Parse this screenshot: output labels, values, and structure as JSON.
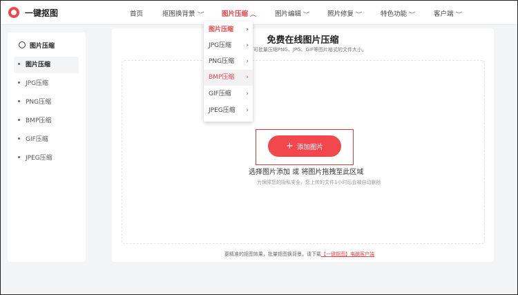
{
  "brand": {
    "name": "一键抠图"
  },
  "nav": {
    "home": "首页",
    "bg_change": "抠图换背景",
    "compress": "图片压缩",
    "edit": "图片编辑",
    "repair": "照片修复",
    "features": "特色功能",
    "client": "客户端"
  },
  "sidebar": {
    "title": "图片压缩",
    "items": [
      "图片压缩",
      "JPG压缩",
      "PNG压缩",
      "BMP压缩",
      "GIF压缩",
      "JPEG压缩"
    ]
  },
  "dropdown": {
    "items": [
      "图片压缩",
      "JPG压缩",
      "PNG压缩",
      "BMP压缩",
      "GIF压缩",
      "JPEG压缩"
    ]
  },
  "main": {
    "title": "免费在线图片压缩",
    "subtitle": "功能，可批量压缩PNG、JPG、GIF等图片格式的文件大小。",
    "add_button": "添加图片",
    "choose_text": "选择图片添加 或 将图片拖拽至此区域",
    "privacy_text": "为保障您的隐私安全，您上传的文件1小时后会被自动删除"
  },
  "footer": {
    "text": "更精准的抠图效果，批量抠图换背景，请下载",
    "link": "【一键抠图】电脑客户端"
  },
  "colors": {
    "accent": "#f3474e",
    "highlight": "#d43c3c"
  }
}
